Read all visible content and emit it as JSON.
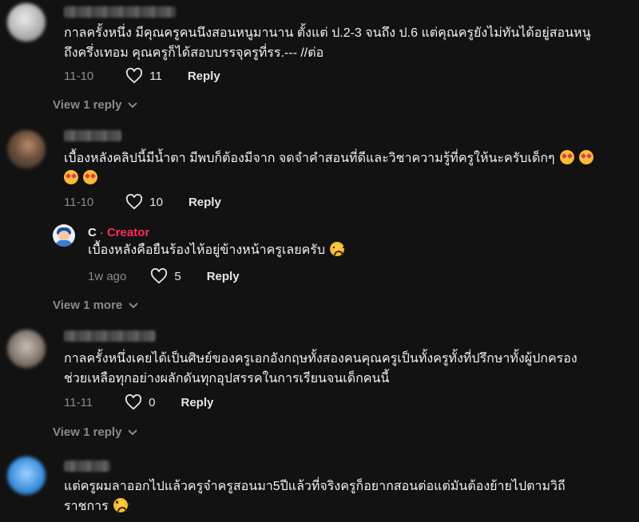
{
  "comments": [
    {
      "text_lines": [
        "กาลครั้งหนึ่ง มีคุณครูคนนึงสอนหนูมานาน ตั้งแต่ ป.2-3 จนถึง ป.6 แต่คุณครูยังไม่ทันได้อยู่สอนหนู",
        "ถึงครึ่งเทอม คุณครูก็ได้สอบบรรจุครูที่รร.--- //ต่อ"
      ],
      "date": "11-10",
      "likes": "11",
      "reply_label": "Reply",
      "view_replies": "View 1 reply"
    },
    {
      "text_lines": [
        "เบื้องหลังคลิปนี้มีน้ำตา มีพบก็ต้องมีจาก จดจำคำสอนที่ดีและวิชาความรู้ที่ครูให้นะครับเด็กๆ",
        ""
      ],
      "emoji_icons": [
        "heart-eyes-emoji",
        "heart-eyes-emoji",
        "heart-eyes-emoji",
        "heart-eyes-emoji"
      ],
      "date": "11-10",
      "likes": "10",
      "reply_label": "Reply",
      "view_replies": "View 1 more"
    },
    {
      "text_lines": [
        "กาลครั้งหนึ่งเคยได้เป็นศิษย์ของครูเอกอังกฤษทั้งสองคนคุณครูเป็นทั้งครูทั้งที่ปรึกษาทั้งผู้ปกครอง",
        "ช่วยเหลือทุกอย่างผลักดันทุกอุปสรรคในการเรียนจนเด็กคนนี้"
      ],
      "date": "11-11",
      "likes": "0",
      "reply_label": "Reply",
      "view_replies": "View 1 reply"
    },
    {
      "text_lines": [
        "แต่ครูผมลาออกไปแล้วครูจ๋าครูสอนมา5ปีแล้วที่จริงครูก็อยากสอนต่อแต่มันต้องย้ายไปตามวิถี",
        "ราชการ"
      ],
      "emoji_icons": [
        "tired-face-emoji"
      ]
    }
  ],
  "creator_reply": {
    "name": "C",
    "separator": "·",
    "badge": "Creator",
    "text": "เบื้องหลังคือยืนร้องไห้อยู่ข้างหน้าครูเลยครับ",
    "emoji_icon": "frowning-face-emoji",
    "date": "1w ago",
    "likes": "5",
    "reply_label": "Reply"
  },
  "colors": {
    "background": "#121212",
    "creator_badge": "#fe2c55",
    "muted": "#8a8a8a"
  }
}
